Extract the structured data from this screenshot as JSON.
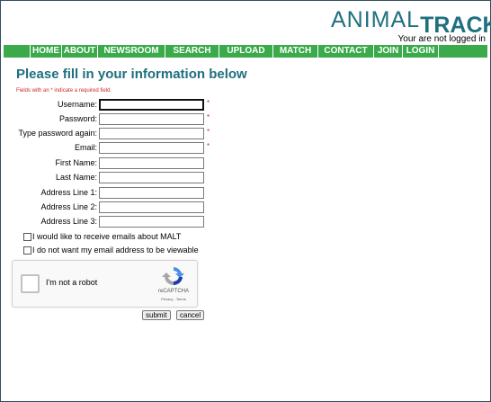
{
  "header": {
    "logo_animal": "ANIMAL",
    "logo_tracks": "TRACKS",
    "login_status": "Your are not logged in"
  },
  "nav": {
    "items": [
      "HOME",
      "ABOUT",
      "NEWSROOM",
      "SEARCH",
      "UPLOAD",
      "MATCH",
      "CONTACT",
      "JOIN",
      "LOGIN"
    ]
  },
  "main": {
    "title": "Please fill in your information below",
    "required_note": "Fields with an * indicate a required field.",
    "fields": [
      {
        "label": "Username:",
        "value": "",
        "required": true,
        "focused": true
      },
      {
        "label": "Password:",
        "value": "",
        "required": true
      },
      {
        "label": "Type password again:",
        "value": "",
        "required": true
      },
      {
        "label": "Email:",
        "value": "",
        "required": true
      },
      {
        "label": "First Name:",
        "value": "",
        "required": false
      },
      {
        "label": "Last Name:",
        "value": "",
        "required": false
      },
      {
        "label": "Address Line 1:",
        "value": "",
        "required": false
      },
      {
        "label": "Address Line 2:",
        "value": "",
        "required": false
      },
      {
        "label": "Address Line 3:",
        "value": "",
        "required": false
      }
    ],
    "required_mark": "*",
    "checkboxes": [
      {
        "label": "I would like to receive emails about MALT",
        "checked": false
      },
      {
        "label": "I do not want my email address to be viewable",
        "checked": false
      }
    ],
    "captcha": {
      "label": "I'm not a robot",
      "brand": "reCAPTCHA",
      "links": "Privacy - Terms"
    },
    "submit_label": "submit",
    "cancel_label": "cancel"
  },
  "colors": {
    "brand_teal": "#1f6f7f",
    "nav_green": "#3aaa4a",
    "required_red": "#cc2a2a"
  }
}
